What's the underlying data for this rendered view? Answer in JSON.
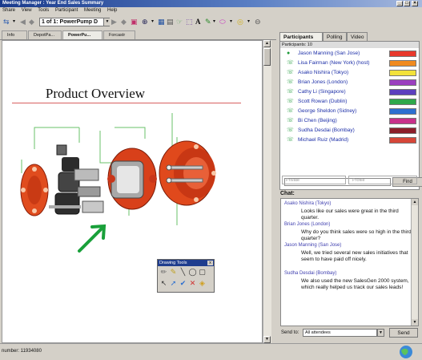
{
  "window": {
    "title": "Meeting Manager : Year End Sales Summary"
  },
  "menu": [
    "Share",
    "View",
    "Tools",
    "Participant",
    "Meeting",
    "Help"
  ],
  "toolbar": {
    "page_select": "1 of 1: PowerPump D"
  },
  "doc_tabs": [
    {
      "label": "Info",
      "active": false
    },
    {
      "label": "DepotPa...",
      "active": false
    },
    {
      "label": "PowerPu...",
      "active": true
    },
    {
      "label": "Forcastr",
      "active": false
    }
  ],
  "slide": {
    "title": "Product Overview"
  },
  "drawing_tools": {
    "title": "Drawing Tools",
    "close": "x"
  },
  "status": {
    "number": "number: 11934080"
  },
  "right_tabs": [
    {
      "label": "Participants",
      "active": true
    },
    {
      "label": "Polling",
      "active": false
    },
    {
      "label": "Video",
      "active": false
    }
  ],
  "participants": {
    "header": "Participants: 10",
    "items": [
      {
        "name": "Jason Manning (San Jose)",
        "color": "#e8392c"
      },
      {
        "name": "Lisa Fairman (New York) (host)",
        "color": "#f08a20"
      },
      {
        "name": "Asako Nishira (Tokyo)",
        "color": "#f2e23a"
      },
      {
        "name": "Brian Jones (London)",
        "color": "#9b3fbf"
      },
      {
        "name": "Cathy Li (Singapore)",
        "color": "#5c3fbe"
      },
      {
        "name": "Scott Rowan (Dublin)",
        "color": "#2ea84a"
      },
      {
        "name": "George Sheldon (Sidney)",
        "color": "#2c6fd0"
      },
      {
        "name": "Bi Chen (Beijing)",
        "color": "#c8308a"
      },
      {
        "name": "Sudha Desdai (Bombay)",
        "color": "#8b1e2a"
      },
      {
        "name": "Michael Ruiz (Madrid)",
        "color": "#d64638"
      }
    ],
    "find_label": "Find",
    "private_label": "Private",
    "profile_label": "Profile"
  },
  "chat": {
    "label": "Chat:",
    "messages": [
      {
        "name": "Asako Nishira (Tokyo)",
        "text": "Looks like our sales were great in the third quarter."
      },
      {
        "name": "Brian Jones (London)",
        "text": "Why do you think sales were so high in the third quarter?"
      },
      {
        "name": "Jason Manning (San Jose)",
        "text": "Well, we tried several new sales initiatives that seem to have paid off nicely."
      },
      {
        "name": "Sudha Desdai (Bombay)",
        "text": "We also used the new SalesGen 2000 system, which really helped us track our sales leads!"
      }
    ],
    "send_to_label": "Send to:",
    "send_to_value": "All attendees",
    "send_label": "Send"
  }
}
